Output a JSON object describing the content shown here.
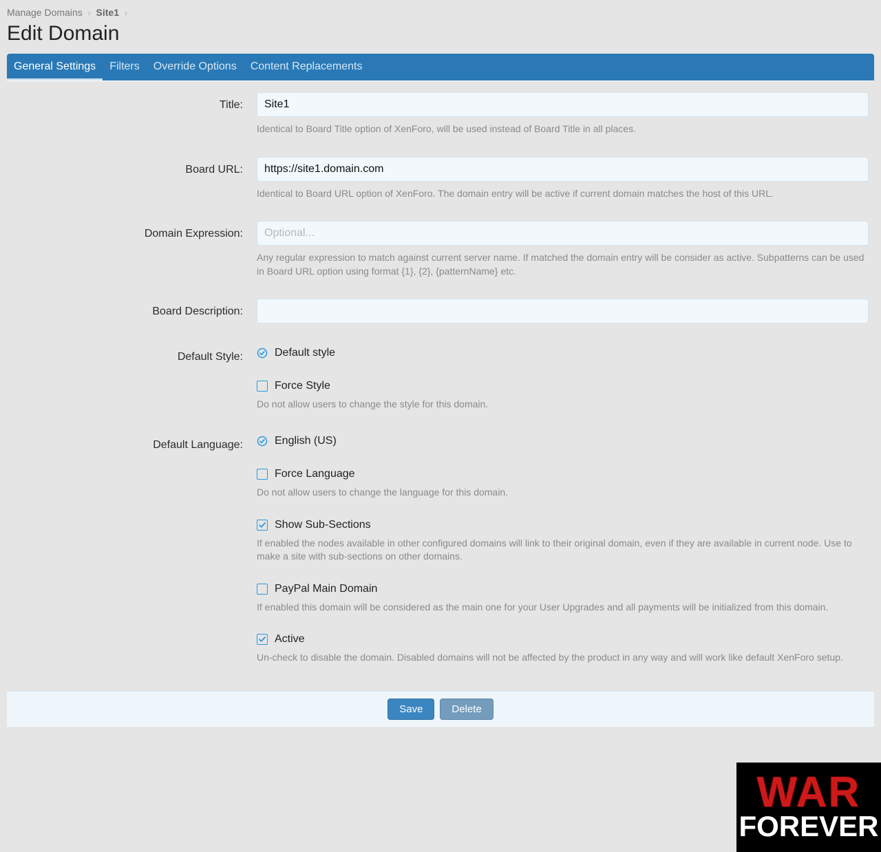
{
  "breadcrumb": {
    "root": "Manage Domains",
    "current": "Site1"
  },
  "page_title": "Edit Domain",
  "tabs": {
    "general": "General Settings",
    "filters": "Filters",
    "override": "Override Options",
    "replacements": "Content Replacements"
  },
  "fields": {
    "title": {
      "label": "Title:",
      "value": "Site1",
      "help": "Identical to Board Title option of XenForo, will be used instead of Board Title in all places."
    },
    "board_url": {
      "label": "Board URL:",
      "value": "https://site1.domain.com",
      "help": "Identical to Board URL option of XenForo. The domain entry will be active if current domain matches the host of this URL."
    },
    "domain_expression": {
      "label": "Domain Expression:",
      "value": "",
      "placeholder": "Optional...",
      "help": "Any regular expression to match against current server name. If matched the domain entry will be consider as active. Subpatterns can be used in Board URL option using format {1}, {2}, {patternName} etc."
    },
    "board_description": {
      "label": "Board Description:",
      "value": ""
    },
    "default_style": {
      "label": "Default Style:",
      "option": "Default style"
    },
    "force_style": {
      "label": "Force Style",
      "help": "Do not allow users to change the style for this domain."
    },
    "default_language": {
      "label": "Default Language:",
      "option": "English (US)"
    },
    "force_language": {
      "label": "Force Language",
      "help": "Do not allow users to change the language for this domain."
    },
    "show_subsections": {
      "label": "Show Sub-Sections",
      "help": "If enabled the nodes available in other configured domains will link to their original domain, even if they are available in current node. Use to make a site with sub-sections on other domains."
    },
    "paypal_main": {
      "label": "PayPal Main Domain",
      "help": "If enabled this domain will be considered as the main one for your User Upgrades and all payments will be initialized from this domain."
    },
    "active": {
      "label": "Active",
      "help": "Un-check to disable the domain. Disabled domains will not be affected by the product in any way and will work like default XenForo setup."
    }
  },
  "buttons": {
    "save": "Save",
    "delete": "Delete"
  },
  "watermark": {
    "line1": "WAR",
    "line2": "FOREVER"
  }
}
